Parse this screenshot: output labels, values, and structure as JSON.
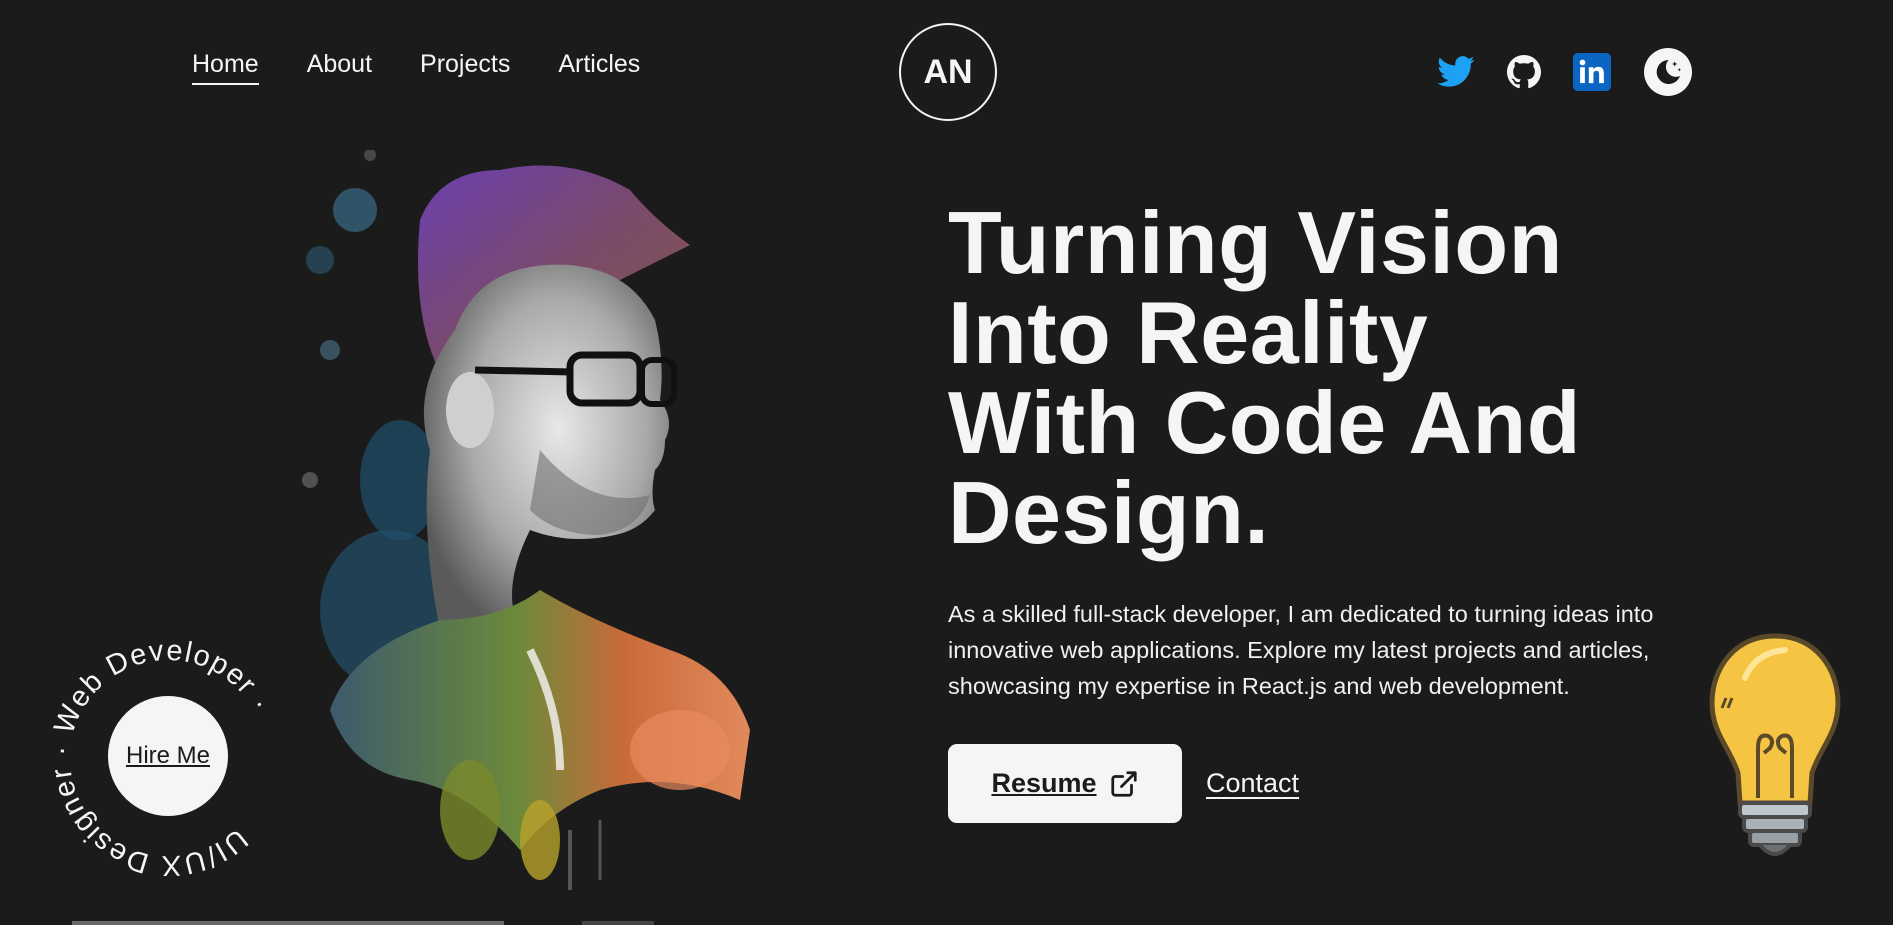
{
  "nav": {
    "items": [
      {
        "label": "Home",
        "active": true
      },
      {
        "label": "About",
        "active": false
      },
      {
        "label": "Projects",
        "active": false
      },
      {
        "label": "Articles",
        "active": false
      }
    ]
  },
  "logo": {
    "text": "AN"
  },
  "socials": {
    "icons": [
      "twitter-icon",
      "github-icon",
      "linkedin-icon",
      "moon-icon"
    ],
    "colors": {
      "twitter": "#1DA1F2",
      "linkedin": "#0A66C2"
    }
  },
  "hero": {
    "headline_lines": [
      "Turning Vision",
      "Into Reality",
      "With Code And",
      "Design."
    ],
    "description": "As a skilled full-stack developer, I am dedicated to turning ideas into innovative web applications. Explore my latest projects and articles, showcasing my expertise in React.js and web development.",
    "resume_label": "Resume",
    "contact_label": "Contact"
  },
  "hire": {
    "label": "Hire Me",
    "ring_text": "UI/UX Designer · Web Developer ·"
  },
  "colors": {
    "background": "#1b1b1b",
    "foreground": "#f5f5f5"
  }
}
